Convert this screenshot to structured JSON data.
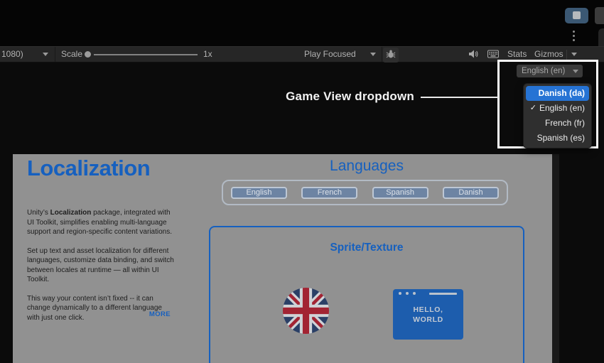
{
  "colors": {
    "accent_blue": "#1660bf",
    "menu_highlight": "#2673d4",
    "page_bg": "#919191",
    "toolbar_bg": "#262626",
    "game_bg": "#0b0b0b",
    "flag_navy": "#2a3f66",
    "flag_red": "#a22433",
    "flag_white": "#cfd2d6"
  },
  "toolbar": {
    "resolution_label": "1080)",
    "scale_label": "Scale",
    "scale_value": "1x",
    "play_focused_label": "Play Focused",
    "stats_label": "Stats",
    "gizmos_label": "Gizmos",
    "icons": [
      "debug-bug-icon",
      "mute-audio-icon",
      "keyboard-icon"
    ]
  },
  "annotation": {
    "label": "Game View dropdown"
  },
  "game_view_dropdown": {
    "selected_label": "English (en)",
    "check_glyph": "✓",
    "items": [
      {
        "label": "Danish (da)",
        "highlighted": true
      },
      {
        "label": "English (en)",
        "checked": true
      },
      {
        "label": "French (fr)"
      },
      {
        "label": "Spanish (es)"
      }
    ]
  },
  "page": {
    "title": "Localization",
    "intro": {
      "p1_prefix": "Unity’s ",
      "p1_bold": "Localization",
      "p1_suffix": " package, integrated with UI Toolkit, simplifies enabling multi-language support and region-specific content variations.",
      "p2": "Set up text and asset localization for different languages, customize data binding, and switch between locales at runtime — all within UI Toolkit.",
      "p3": "This way your content isn’t fixed -- it can change dynamically to a different language with just one click."
    },
    "more_label": "MORE",
    "languages": {
      "heading": "Languages",
      "buttons": [
        "English",
        "French",
        "Spanish",
        "Danish"
      ]
    },
    "sprite_section": {
      "heading": "Sprite/Texture",
      "window_text": [
        "HELLO,",
        "WORLD"
      ]
    }
  }
}
